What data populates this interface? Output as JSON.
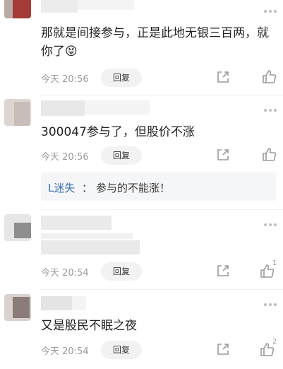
{
  "comments": [
    {
      "text": "那就是间接参与，正是此地无银三百两，就你了",
      "emoji": "😝",
      "time": "今天 20:56",
      "reply_label": "回复"
    },
    {
      "text": "300047参与了，但股价不涨",
      "time": "今天 20:56",
      "reply_label": "回复",
      "sub_reply": {
        "user": "L迷失",
        "colon": "：",
        "text": "参与的不能涨！"
      }
    },
    {
      "time": "今天 20:54",
      "reply_label": "回复",
      "like_count": "1"
    },
    {
      "text": "又是股民不眠之夜",
      "time": "今天 20:54",
      "reply_label": "回复",
      "like_count": "2"
    }
  ],
  "colors": {
    "link_blue": "#3b6fb6",
    "time_gray": "#999999",
    "icon_gray": "#9a9a9a"
  }
}
